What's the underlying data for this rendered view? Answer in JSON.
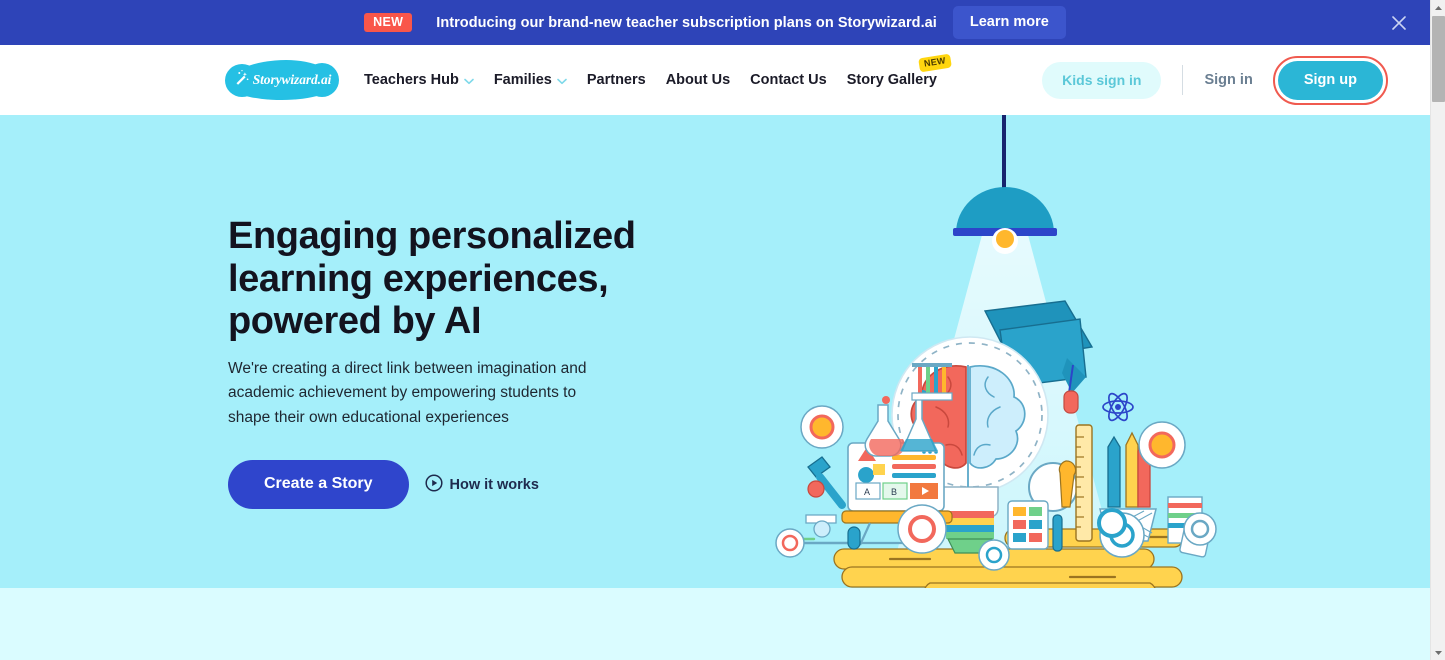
{
  "colors": {
    "banner_bg": "#2e44b8",
    "banner_badge": "#f9564a",
    "banner_cta": "#3c55cc",
    "hero_bg": "#a5effa",
    "section_bg": "#dafcff",
    "brand_cyan": "#25c0e4",
    "signup_cyan": "#2bb6d6",
    "highlight_ring": "#f05a4f",
    "primary_blue": "#2f45cc",
    "badge_yellow": "#ffd60f",
    "kids_pill_bg": "#e0fbfc",
    "kids_pill_text": "#5bc8d8"
  },
  "banner": {
    "badge": "NEW",
    "message": "Introducing our brand-new teacher subscription plans on Storywizard.ai",
    "cta_label": "Learn more",
    "close_icon": "close-icon"
  },
  "header": {
    "logo": {
      "text": "Storywizard.ai",
      "icon": "magic-wand-icon"
    },
    "nav_items": [
      {
        "label": "Teachers Hub",
        "has_dropdown": true,
        "badge": ""
      },
      {
        "label": "Families",
        "has_dropdown": true,
        "badge": ""
      },
      {
        "label": "Partners",
        "has_dropdown": false,
        "badge": ""
      },
      {
        "label": "About Us",
        "has_dropdown": false,
        "badge": ""
      },
      {
        "label": "Contact Us",
        "has_dropdown": false,
        "badge": ""
      },
      {
        "label": "Story Gallery",
        "has_dropdown": false,
        "badge": "NEW"
      }
    ],
    "kids_signin_label": "Kids sign in",
    "signin_label": "Sign in",
    "signup_label": "Sign up"
  },
  "hero": {
    "title": "Engaging personalized learning experiences, powered by AI",
    "subtitle": "We're creating a direct link between imagination and academic achievement by empowering students to shape their own educational experiences",
    "primary_cta": "Create a Story",
    "secondary_cta": "How it works",
    "secondary_cta_icon": "play-circle-icon",
    "illustration": "education-lightbulb-brain-illustration"
  },
  "scrollbar": {
    "up_icon": "chevron-up-icon",
    "down_icon": "chevron-down-icon"
  }
}
